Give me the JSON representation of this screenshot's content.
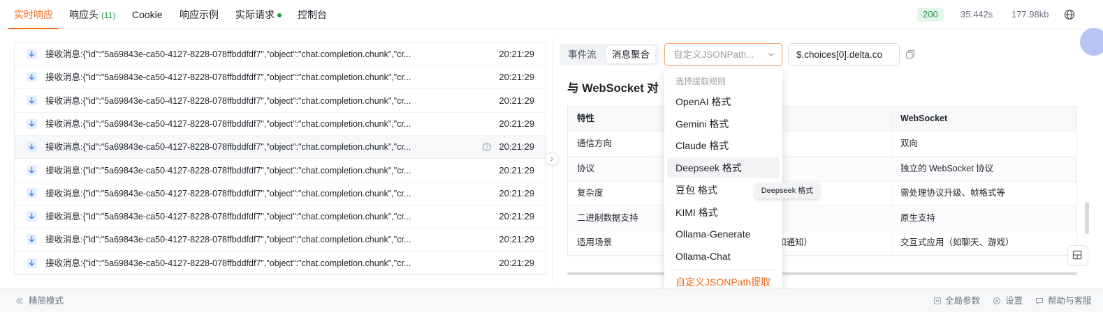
{
  "tabs": {
    "realtime": "实时响应",
    "headers": "响应头",
    "headers_count": "(11)",
    "cookie": "Cookie",
    "example": "响应示例",
    "actual": "实际请求",
    "console": "控制台"
  },
  "stats": {
    "status": "200",
    "time": "35.442s",
    "size": "177.98kb"
  },
  "messages": [
    {
      "text": "接收消息:{\"id\":\"5a69843e-ca50-4127-8228-078ffbddfdf7\",\"object\":\"chat.completion.chunk\",\"cr...",
      "time": "20:21:29"
    },
    {
      "text": "接收消息:{\"id\":\"5a69843e-ca50-4127-8228-078ffbddfdf7\",\"object\":\"chat.completion.chunk\",\"cr...",
      "time": "20:21:29"
    },
    {
      "text": "接收消息:{\"id\":\"5a69843e-ca50-4127-8228-078ffbddfdf7\",\"object\":\"chat.completion.chunk\",\"cr...",
      "time": "20:21:29"
    },
    {
      "text": "接收消息:{\"id\":\"5a69843e-ca50-4127-8228-078ffbddfdf7\",\"object\":\"chat.completion.chunk\",\"cr...",
      "time": "20:21:29"
    },
    {
      "text": "接收消息:{\"id\":\"5a69843e-ca50-4127-8228-078ffbddfdf7\",\"object\":\"chat.completion.chunk\",\"cr...",
      "time": "20:21:29"
    },
    {
      "text": "接收消息:{\"id\":\"5a69843e-ca50-4127-8228-078ffbddfdf7\",\"object\":\"chat.completion.chunk\",\"cr...",
      "time": "20:21:29"
    },
    {
      "text": "接收消息:{\"id\":\"5a69843e-ca50-4127-8228-078ffbddfdf7\",\"object\":\"chat.completion.chunk\",\"cr...",
      "time": "20:21:29"
    },
    {
      "text": "接收消息:{\"id\":\"5a69843e-ca50-4127-8228-078ffbddfdf7\",\"object\":\"chat.completion.chunk\",\"cr...",
      "time": "20:21:29"
    },
    {
      "text": "接收消息:{\"id\":\"5a69843e-ca50-4127-8228-078ffbddfdf7\",\"object\":\"chat.completion.chunk\",\"cr...",
      "time": "20:21:29"
    },
    {
      "text": "接收消息:{\"id\":\"5a69843e-ca50-4127-8228-078ffbddfdf7\",\"object\":\"chat.completion.chunk\",\"cr...",
      "time": "20:21:29"
    }
  ],
  "toolbar": {
    "event_stream": "事件流",
    "aggregate": "消息聚合",
    "select_placeholder": "自定义JSONPath...",
    "jsonpath_value": "$.choices[0].delta.co"
  },
  "content": {
    "title": "与 WebSocket 对",
    "table": {
      "header": {
        "feature": "特性",
        "ws": "WebSocket"
      },
      "rows": [
        {
          "feature": "通信方向",
          "middle": "",
          "ws": "双向"
        },
        {
          "feature": "协议",
          "middle": "",
          "ws": "独立的 WebSocket 协议"
        },
        {
          "feature": "复杂度",
          "middle": "",
          "ws": "需处理协议升级、帧格式等"
        },
        {
          "feature": "二进制数据支持",
          "middle": "",
          "ws": "原生支持"
        },
        {
          "feature": "适用场景",
          "middle": "如通知）",
          "ws": "交互式应用（如聊天、游戏）"
        }
      ]
    }
  },
  "dropdown": {
    "title": "选择提取规则",
    "items": [
      "OpenAI 格式",
      "Gemini 格式",
      "Claude 格式",
      "Deepseek 格式",
      "豆包 格式",
      "KIMI 格式",
      "Ollama-Generate",
      "Ollama-Chat"
    ],
    "custom": "自定义JSONPath提取",
    "tooltip": "Deepseek 格式"
  },
  "footer": {
    "simple_mode": "精简模式",
    "global_params": "全局参数",
    "settings": "设置",
    "help": "帮助与客服"
  },
  "colors": {
    "accent": "#f26b1d",
    "success": "#1f9a48",
    "arrow_icon": "#3b82f6"
  }
}
